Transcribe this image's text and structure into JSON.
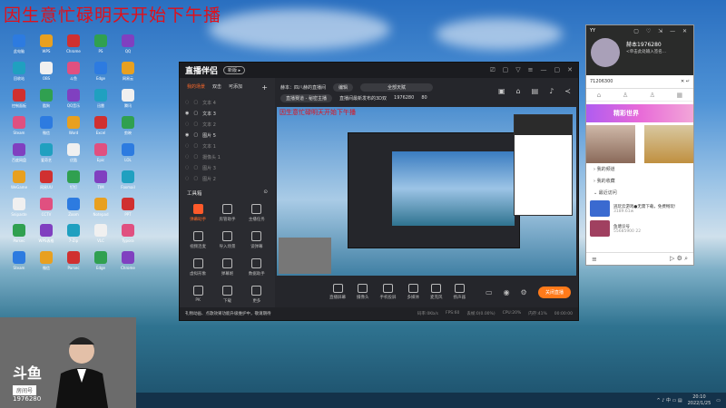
{
  "banner": "因生意忙碌明天开始下午播",
  "desktop_icons": [
    "此电脑",
    "WPS",
    "Chrome",
    "PS",
    "QQ",
    "回收站",
    "OBS",
    "斗鱼",
    "Edge",
    "网易云",
    "控制面板",
    "酷狗",
    "QQ音乐",
    "迅雷",
    "腾讯",
    "Steam",
    "微信",
    "Word",
    "Excel",
    "剪映",
    "百度网盘",
    "爱奇艺",
    "优酷",
    "Epic",
    "LOL",
    "WeGame",
    "网易UU",
    "钉钉",
    "TIM",
    "Foxmail",
    "Snipaste",
    "CCTV",
    "Zoom",
    "Notepad",
    "PPT",
    "Parsec",
    "WPS表格",
    "7-Zip",
    "VLC",
    "Typora",
    "Steam",
    "微信",
    "Parsec",
    "Edge",
    "Chrome"
  ],
  "webcam": {
    "logo": "斗鱼",
    "room_label": "房间号",
    "room_number": "1976280"
  },
  "app": {
    "brand": "直播伴侣",
    "beta": "新版 ▸",
    "window_controls": [
      "⎚",
      "▢",
      "▽",
      "≡",
      "—",
      "▢",
      "✕"
    ],
    "scene_tabs": [
      "我的场景",
      "双击",
      "可添加"
    ],
    "add": "+",
    "scenes": [
      {
        "name": "文本 4",
        "on": false
      },
      {
        "name": "文本 3",
        "on": true
      },
      {
        "name": "文本 2",
        "on": false
      },
      {
        "name": "图片 5",
        "on": true
      },
      {
        "name": "文本 1",
        "on": false
      },
      {
        "name": "摄像头 1",
        "on": false
      },
      {
        "name": "图片 3",
        "on": false
      },
      {
        "name": "图片 2",
        "on": false
      }
    ],
    "toolbox_title": "工具箱",
    "tools": [
      "弹幕助手",
      "房管助手",
      "主播任务",
      "视频连麦",
      "导入场景",
      "谈弹幕",
      "虚拟形象",
      "弹幕姬",
      "数据助手",
      "PK",
      "下载",
      "更多"
    ],
    "room_title_label": "赫本：四八赫的直播间",
    "edit": "编辑",
    "category": "全部天赋",
    "tag": "直播赛道 - 秘密主播",
    "announcement": "直播间最新发布的3D双",
    "room_id": "1976280",
    "hot": "80",
    "preview_banner": "因生意忙碌明天开始下午播",
    "bottom_buttons": [
      "直播屏幕",
      "摄像头",
      "手机投屏",
      "多媒体",
      "麦克风",
      "扬声器"
    ],
    "go_live": "关闭直播",
    "status_warn": "礼物动画、点歌效果功能升级维护中，敬请期待",
    "stats": [
      "码率:0Kb/s",
      "FPS:60",
      "丢帧:0(0.00%)",
      "CPU:20%",
      "内存:41%"
    ],
    "timer": "00:00:00"
  },
  "yy": {
    "app": "YY",
    "window_controls": "▢ ♡ ⇲ — ✕",
    "name": "赫本1976280",
    "signature": "<单击此处输入签名...",
    "search_value": "71206300",
    "search_icons": "✕ ↵",
    "nav": [
      "⌂",
      "♙",
      "♙",
      "▦"
    ],
    "promo": "精彩世界",
    "sections": [
      "› 我的频道",
      "› 我的收藏",
      "⌄ 最近访问"
    ],
    "recent": [
      {
        "title": "逃玩云游戏●无需下载，免费畅玩!",
        "meta": "3189.61w"
      },
      {
        "title": "鱼塘诊号",
        "meta": "55685900   22"
      }
    ],
    "footer": [
      "≡",
      "▷ ⚙ ⌕"
    ]
  },
  "taskbar": {
    "tray": "^ ♪ 中 ▭ ▤",
    "time": "20:10",
    "date": "2022/1/25"
  }
}
